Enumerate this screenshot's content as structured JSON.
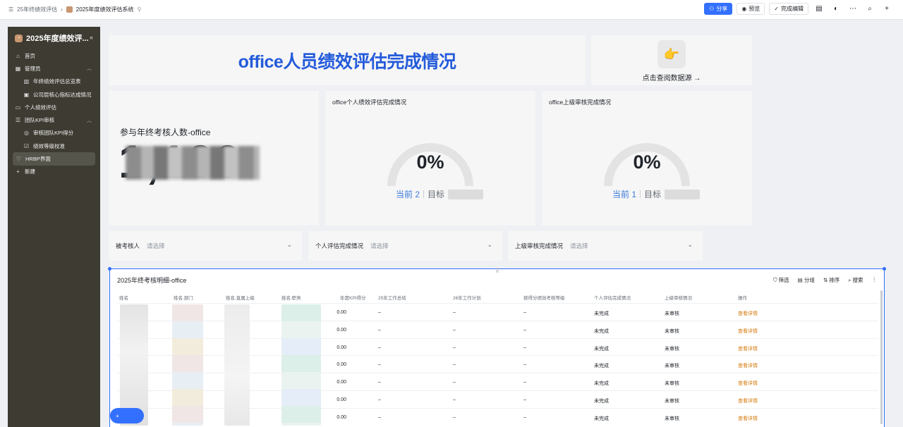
{
  "topbar": {
    "breadcrumb_root": "25年终绩效评估",
    "breadcrumb_current": "2025年度绩效评估系统",
    "share": "分享",
    "preview": "预览",
    "finish_edit": "完成编辑"
  },
  "sidebar": {
    "app_title": "2025年度绩效评...",
    "items": [
      {
        "label": "首页",
        "icon": "home-icon"
      },
      {
        "label": "管理员",
        "icon": "grid-icon"
      },
      {
        "label": "年终绩效评估总览表",
        "icon": "chart-icon"
      },
      {
        "label": "公司层核心指标达成情况",
        "icon": "dashboard-icon"
      },
      {
        "label": "个人绩效评估",
        "icon": "form-icon"
      },
      {
        "label": "团队KPI审核",
        "icon": "list-icon"
      },
      {
        "label": "审核团队KPI得分",
        "icon": "eye-icon"
      },
      {
        "label": "绩效等级校准",
        "icon": "check-icon"
      },
      {
        "label": "HRBP界面",
        "icon": "bulb-icon"
      },
      {
        "label": "新建",
        "icon": "plus-icon"
      }
    ]
  },
  "dashboard": {
    "title": "office人员绩效评估完成情况",
    "source_link": "点击查阅数据源 →",
    "kpi_label": "参与年终考核人数-office",
    "kpi_value": "1,100",
    "gauge1": {
      "title": "office个人绩效评估完成情况",
      "percent": "0%",
      "current": "当前 2",
      "target": "目标"
    },
    "gauge2": {
      "title": "office上级审核完成情况",
      "percent": "0%",
      "current": "当前 1",
      "target": "目标"
    }
  },
  "filters": [
    {
      "label": "被考核人",
      "placeholder": "请选择"
    },
    {
      "label": "个人评估完成情况",
      "placeholder": "请选择"
    },
    {
      "label": "上级审核完成情况",
      "placeholder": "请选择"
    }
  ],
  "table": {
    "title": "2025年终考核明细-office",
    "tools": [
      "筛选",
      "分组",
      "排序",
      "搜索"
    ],
    "columns": [
      "姓名",
      "姓名.部门",
      "姓名.直属上级",
      "姓名.职务",
      "年度KPI得分",
      "25年工作总结",
      "26年工作计划",
      "按得分绩效考核等级",
      "个人评估完成情况",
      "上级审核情况",
      "操作"
    ],
    "rows": [
      {
        "kpi": "0.00",
        "summary": "–",
        "plan": "–",
        "grade": "–",
        "self": "未完成",
        "review": "未审核",
        "action": "查看详情"
      },
      {
        "kpi": "0.00",
        "summary": "–",
        "plan": "–",
        "grade": "–",
        "self": "未完成",
        "review": "未审核",
        "action": "查看详情"
      },
      {
        "kpi": "0.00",
        "summary": "–",
        "plan": "–",
        "grade": "–",
        "self": "未完成",
        "review": "未审核",
        "action": "查看详情"
      },
      {
        "kpi": "0.00",
        "summary": "–",
        "plan": "–",
        "grade": "–",
        "self": "未完成",
        "review": "未审核",
        "action": "查看详情"
      },
      {
        "kpi": "0.00",
        "summary": "–",
        "plan": "–",
        "grade": "–",
        "self": "未完成",
        "review": "未审核",
        "action": "查看详情"
      },
      {
        "kpi": "0.00",
        "summary": "–",
        "plan": "–",
        "grade": "–",
        "self": "未完成",
        "review": "未审核",
        "action": "查看详情"
      },
      {
        "kpi": "0.00",
        "summary": "–",
        "plan": "–",
        "grade": "–",
        "self": "未完成",
        "review": "未审核",
        "action": "查看详情"
      }
    ]
  },
  "colors": {
    "accent": "#3370ff",
    "title_blue": "#245bdb",
    "link_orange": "#d4790a",
    "sidebar_bg": "#3d3b32"
  }
}
